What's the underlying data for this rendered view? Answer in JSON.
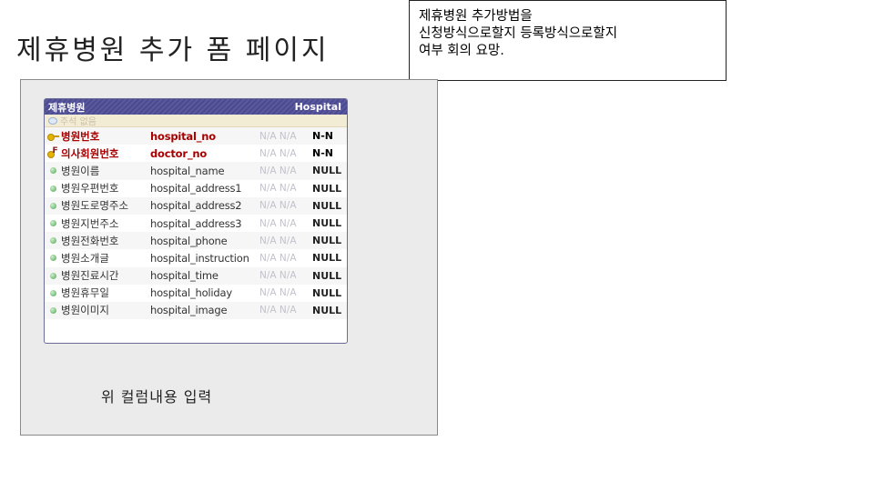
{
  "slide": {
    "title": "제휴병원 추가 폼 페이지",
    "note_lines": [
      "제휴병원 추가방법을",
      "신청방식으로할지 등록방식으로할지",
      "여부 회의 요망."
    ],
    "panel_caption": "위 컬럼내용 입력"
  },
  "entity": {
    "name": "제휴병원",
    "physical_name": "Hospital",
    "comment_placeholder": "주석 없음",
    "columns": [
      {
        "kor": "병원번호",
        "eng": "hospital_no",
        "na1": "N/A",
        "na2": "N/A",
        "null": "N-N",
        "icon": "primary-key-icon",
        "pk": true
      },
      {
        "kor": "의사회원번호",
        "eng": "doctor_no",
        "na1": "N/A",
        "na2": "N/A",
        "null": "N-N",
        "icon": "foreign-key-icon",
        "pk": true
      },
      {
        "kor": "병원이름",
        "eng": "hospital_name",
        "na1": "N/A",
        "na2": "N/A",
        "null": "NULL",
        "icon": "column-dot-icon",
        "pk": false
      },
      {
        "kor": "병원우편번호",
        "eng": "hospital_address1",
        "na1": "N/A",
        "na2": "N/A",
        "null": "NULL",
        "icon": "column-dot-icon",
        "pk": false
      },
      {
        "kor": "병원도로명주소",
        "eng": "hospital_address2",
        "na1": "N/A",
        "na2": "N/A",
        "null": "NULL",
        "icon": "column-dot-icon",
        "pk": false
      },
      {
        "kor": "병원지번주소",
        "eng": "hospital_address3",
        "na1": "N/A",
        "na2": "N/A",
        "null": "NULL",
        "icon": "column-dot-icon",
        "pk": false
      },
      {
        "kor": "병원전화번호",
        "eng": "hospital_phone",
        "na1": "N/A",
        "na2": "N/A",
        "null": "NULL",
        "icon": "column-dot-icon",
        "pk": false
      },
      {
        "kor": "병원소개글",
        "eng": "hospital_instruction",
        "na1": "N/A",
        "na2": "N/A",
        "null": "NULL",
        "icon": "column-dot-icon",
        "pk": false
      },
      {
        "kor": "병원진료시간",
        "eng": "hospital_time",
        "na1": "N/A",
        "na2": "N/A",
        "null": "NULL",
        "icon": "column-dot-icon",
        "pk": false
      },
      {
        "kor": "병원휴무일",
        "eng": "hospital_holiday",
        "na1": "N/A",
        "na2": "N/A",
        "null": "NULL",
        "icon": "column-dot-icon",
        "pk": false
      },
      {
        "kor": "병원이미지",
        "eng": "hospital_image",
        "na1": "N/A",
        "na2": "N/A",
        "null": "NULL",
        "icon": "column-dot-icon",
        "pk": false
      }
    ]
  }
}
